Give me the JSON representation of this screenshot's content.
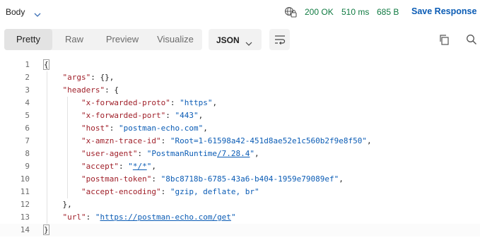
{
  "response_tab": {
    "label": "Body"
  },
  "status": {
    "code": "200 OK",
    "time": "510 ms",
    "size": "685 B",
    "color": "#0f7a41"
  },
  "actions": {
    "save_label": "Save Response"
  },
  "view_tabs": [
    {
      "label": "Pretty",
      "active": true
    },
    {
      "label": "Raw",
      "active": false
    },
    {
      "label": "Preview",
      "active": false
    },
    {
      "label": "Visualize",
      "active": false
    }
  ],
  "format_select": {
    "value": "JSON"
  },
  "icons": {
    "globe": "network-globe-icon",
    "wrap": "text-wrap-icon",
    "copy": "copy-icon",
    "search": "search-icon"
  },
  "code": {
    "line_numbers": [
      "1",
      "2",
      "3",
      "4",
      "5",
      "6",
      "7",
      "8",
      "9",
      "10",
      "11",
      "12",
      "13",
      "14"
    ],
    "open_brace": "{",
    "args_key": "\"args\"",
    "args_val": "{},",
    "headers_key": "\"headers\"",
    "headers_open": "{",
    "h1_key": "\"x-forwarded-proto\"",
    "h1_val": "\"https\"",
    "h2_key": "\"x-forwarded-port\"",
    "h2_val": "\"443\"",
    "h3_key": "\"host\"",
    "h3_val": "\"postman-echo.com\"",
    "h4_key": "\"x-amzn-trace-id\"",
    "h4_val": "\"Root=1-61598a42-451d8ae52e1c560b2f9e8f50\"",
    "h5_key": "\"user-agent\"",
    "h5_val_a": "\"PostmanRuntime",
    "h5_val_b": "/7.28.4",
    "h5_val_c": "\"",
    "h6_key": "\"accept\"",
    "h6_val_a": "\"",
    "h6_val_b": "*/*",
    "h6_val_c": "\"",
    "h7_key": "\"postman-token\"",
    "h7_val": "\"8bc8718b-6785-43a6-b404-1959e79089ef\"",
    "h8_key": "\"accept-encoding\"",
    "h8_val": "\"gzip, deflate, br\"",
    "headers_close": "},",
    "url_key": "\"url\"",
    "url_q1": "\"",
    "url_val": "https://postman-echo.com/get",
    "url_q2": "\"",
    "close_brace": "}",
    "key_color": "#a0202a",
    "value_color": "#0b5cb5"
  }
}
